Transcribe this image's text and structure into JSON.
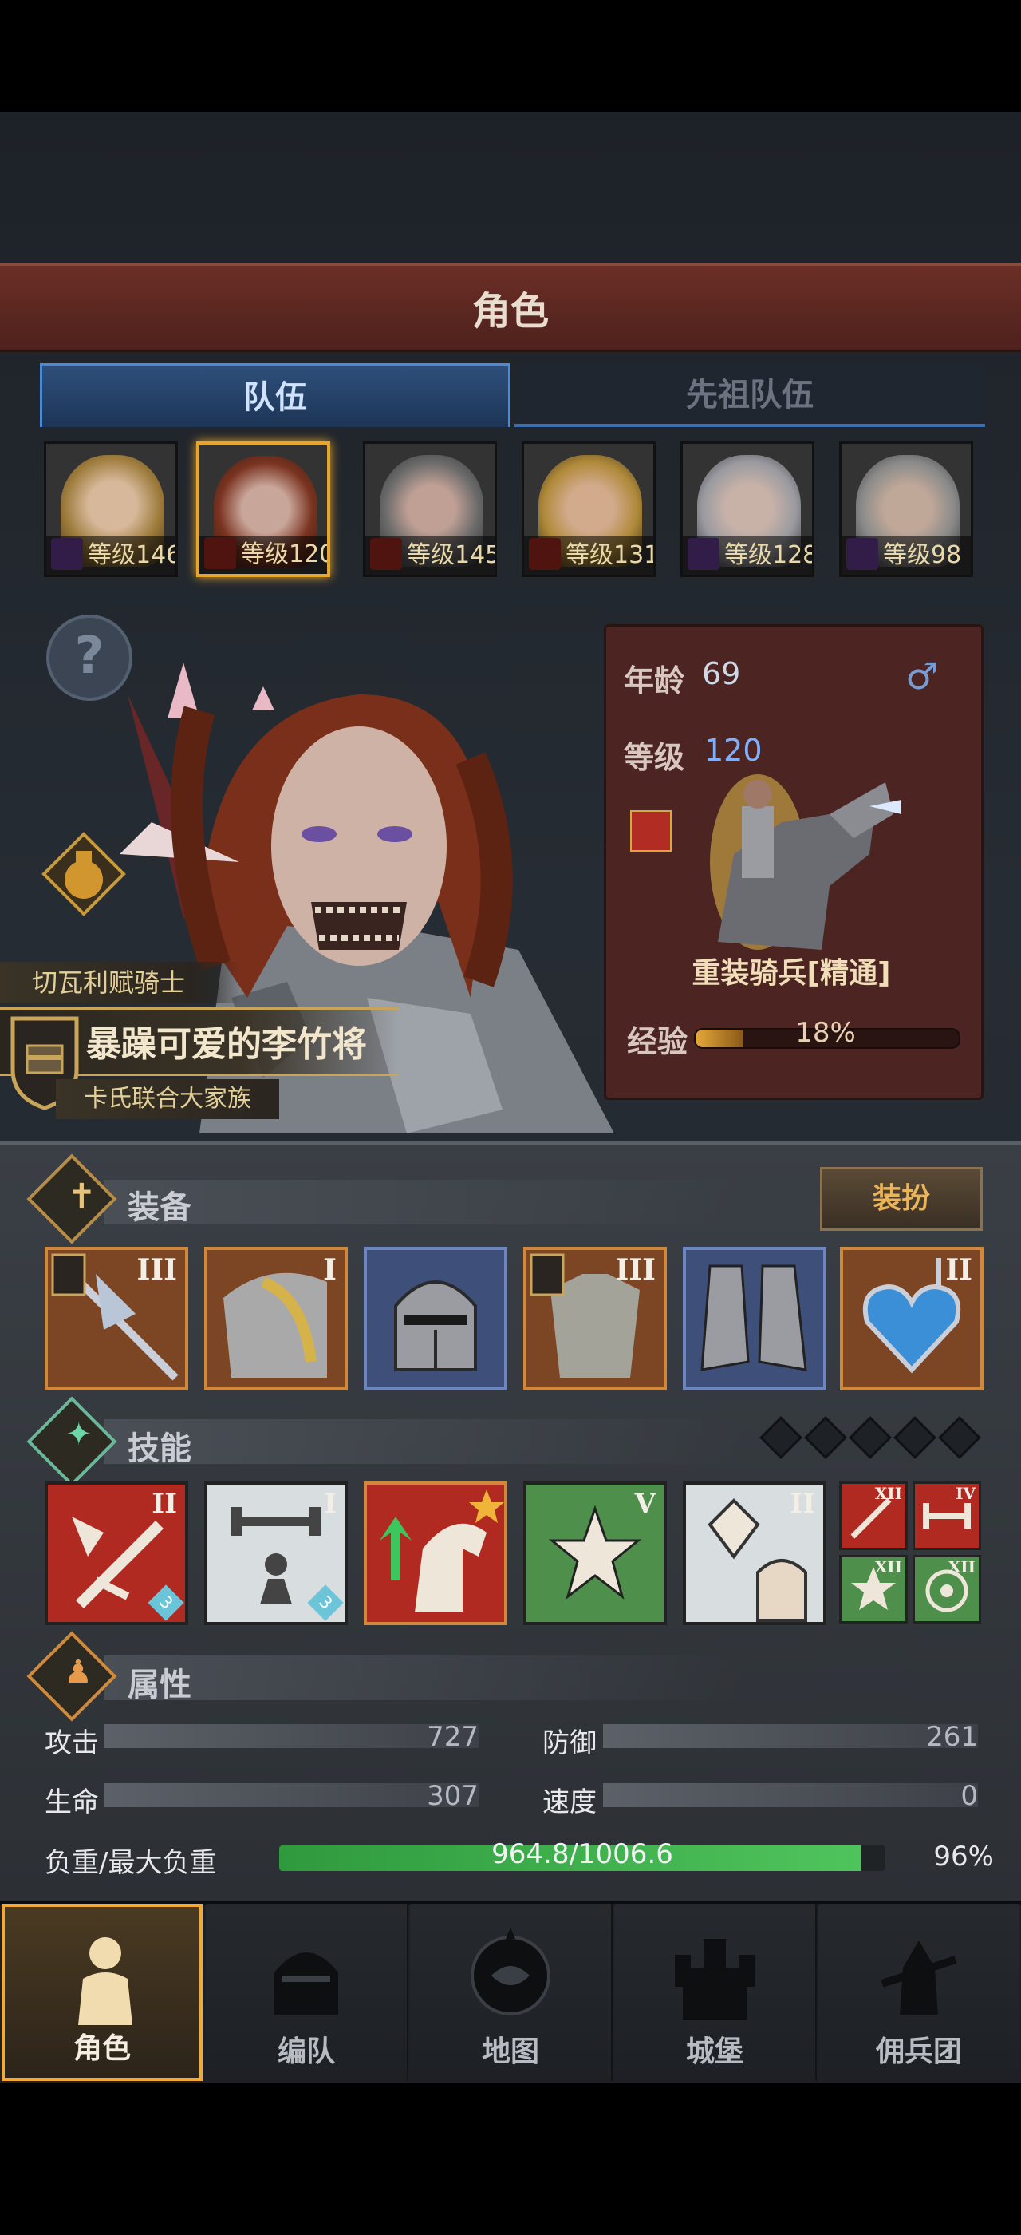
{
  "header": {
    "title": "角色"
  },
  "tabs": [
    {
      "label": "队伍"
    },
    {
      "label": "先祖队伍"
    }
  ],
  "roster": [
    {
      "level": "等级146",
      "class": "purple"
    },
    {
      "level": "等级120",
      "class": "red",
      "selected": true
    },
    {
      "level": "等级145",
      "class": "red"
    },
    {
      "level": "等级131",
      "class": "red"
    },
    {
      "level": "等级128",
      "class": "purple"
    },
    {
      "level": "等级98",
      "class": "purple"
    }
  ],
  "character": {
    "subtitle": "切瓦利赋骑士",
    "name": "暴躁可爱的李竹将",
    "family": "卡氏联合大家族"
  },
  "info": {
    "age_label": "年龄",
    "age": "69",
    "level_label": "等级",
    "level": "120",
    "unit": "重装骑兵[精通]",
    "exp_label": "经验",
    "exp_pct_text": "18%",
    "exp_pct": 18
  },
  "equipment": {
    "title": "装备",
    "dress_button": "装扮",
    "items": [
      {
        "icon": "halberd-icon",
        "rank": "III",
        "style": "orange"
      },
      {
        "icon": "pauldron-icon",
        "rank": "I",
        "style": "orange"
      },
      {
        "icon": "helmet-icon",
        "rank": "",
        "style": "blue"
      },
      {
        "icon": "armor-icon",
        "rank": "III",
        "style": "orange"
      },
      {
        "icon": "boots-icon",
        "rank": "",
        "style": "blue"
      },
      {
        "icon": "heart-amulet-icon",
        "rank": "II",
        "style": "orange"
      }
    ]
  },
  "skills": {
    "title": "技能",
    "items": [
      {
        "icon": "broken-sword-icon",
        "rank": "II",
        "style": "red",
        "badge": "3"
      },
      {
        "icon": "strength-aura-icon",
        "rank": "I",
        "style": "white",
        "badge": "3"
      },
      {
        "icon": "horse-charge-icon",
        "rank": "",
        "style": "red",
        "badge": ""
      },
      {
        "icon": "crystal-burst-icon",
        "rank": "V",
        "style": "green",
        "badge": ""
      },
      {
        "icon": "crystal-hand-icon",
        "rank": "II",
        "style": "white",
        "badge": ""
      }
    ],
    "mini": [
      {
        "icon": "sword-mini-icon",
        "rank": "XII",
        "style": "red"
      },
      {
        "icon": "barbell-mini-icon",
        "rank": "IV",
        "style": "red"
      },
      {
        "icon": "burst-mini-icon",
        "rank": "XII",
        "style": "green"
      },
      {
        "icon": "target-mini-icon",
        "rank": "XII",
        "style": "green"
      }
    ]
  },
  "attributes": {
    "title": "属性",
    "attack_label": "攻击",
    "attack": "727",
    "defense_label": "防御",
    "defense": "261",
    "hp_label": "生命",
    "hp": "307",
    "speed_label": "速度",
    "speed": "0",
    "load_label": "负重/最大负重",
    "load_text": "964.8/1006.6",
    "load_pct_text": "96%",
    "load_pct": 96
  },
  "nav": [
    {
      "label": "角色",
      "icon": "knight-icon",
      "selected": true
    },
    {
      "label": "编队",
      "icon": "helmet-squad-icon"
    },
    {
      "label": "地图",
      "icon": "compass-map-icon"
    },
    {
      "label": "城堡",
      "icon": "castle-icon"
    },
    {
      "label": "佣兵团",
      "icon": "mercenary-icon"
    }
  ],
  "colors": {
    "accent_gold": "#e7a52a",
    "tab_blue": "#4b8ad6",
    "load_green": "#4fc45c"
  }
}
